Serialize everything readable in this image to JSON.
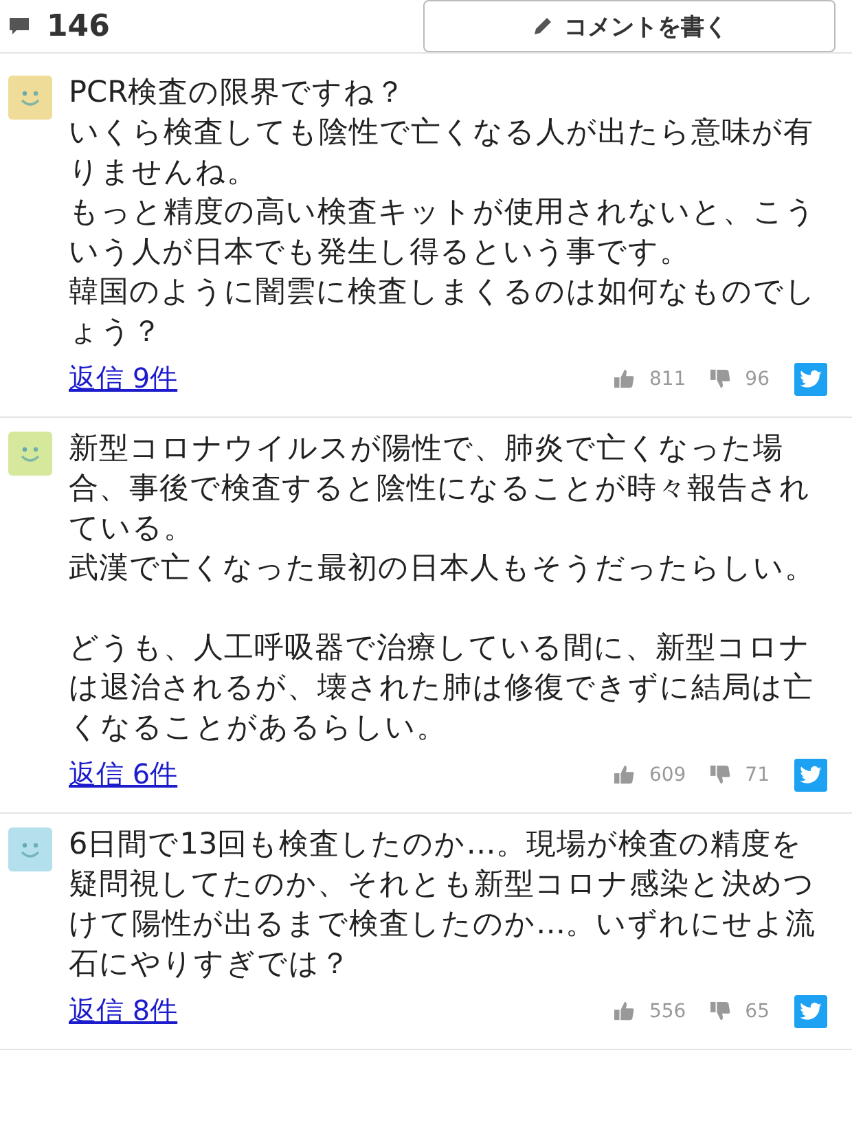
{
  "header": {
    "comment_count": "146",
    "write_button": "コメントを書く"
  },
  "comments": [
    {
      "color": "#eedc98",
      "sections": [
        [
          "PCR検査の限界ですね？",
          "いくら検査しても陰性で亡くなる人が出たら意味が有りませんね。",
          "もっと精度の高い検査キットが使用されないと、こういう人が日本でも発生し得るという事です。",
          "韓国のように闇雲に検査しまくるのは如何なものでしょう？"
        ]
      ],
      "replies": "返信 9件",
      "likes": "811",
      "dislikes": "96"
    },
    {
      "color": "#d6e89c",
      "sections": [
        [
          "新型コロナウイルスが陽性で、肺炎で亡くなった場合、事後で検査すると陰性になることが時々報告されている。",
          "武漢で亡くなった最初の日本人もそうだったらしい。"
        ],
        [
          "どうも、人工呼吸器で治療している間に、新型コロナは退治されるが、壊された肺は修復できずに結局は亡くなることがあるらしい。"
        ]
      ],
      "replies": "返信 6件",
      "likes": "609",
      "dislikes": "71"
    },
    {
      "color": "#b4e0ee",
      "sections": [
        [
          "6日間で13回も検査したのか…。現場が検査の精度を疑問視してたのか、それとも新型コロナ感染と決めつけて陽性が出るまで検査したのか…。いずれにせよ流石にやりすぎでは？"
        ]
      ],
      "replies": "返信 8件",
      "likes": "556",
      "dislikes": "65"
    }
  ]
}
